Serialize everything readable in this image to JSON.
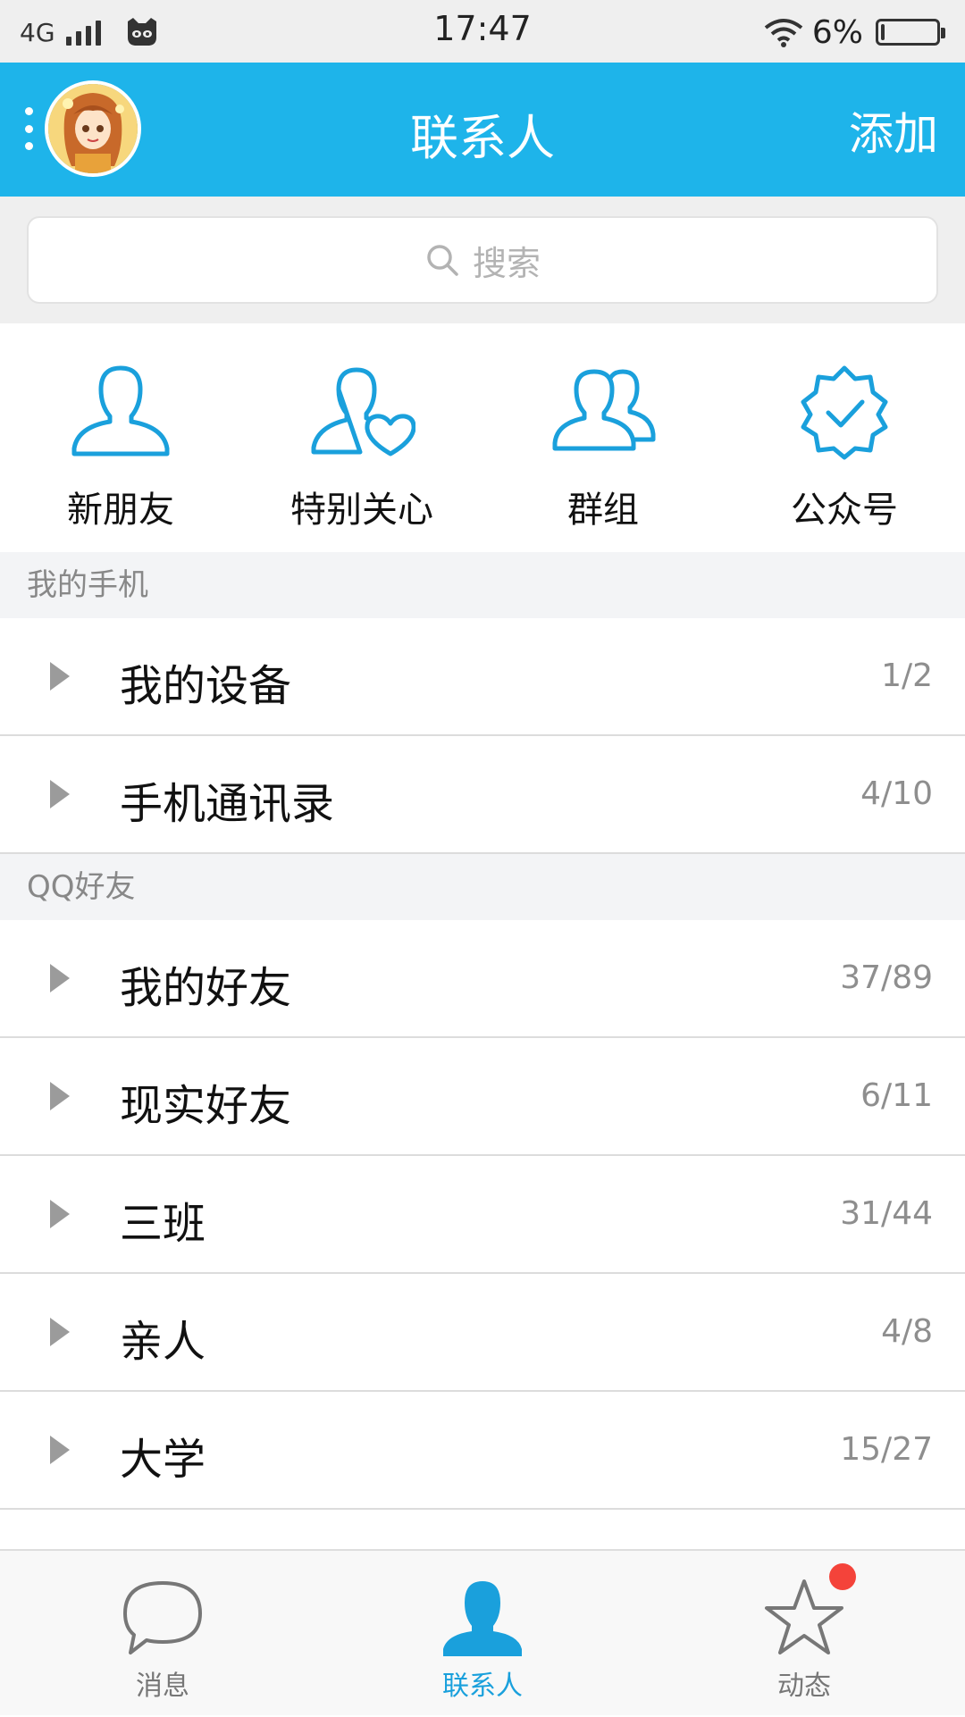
{
  "status_bar": {
    "network": "4G",
    "time": "17:47",
    "battery_text": "6%",
    "battery_level": 0.06
  },
  "header": {
    "title": "联系人",
    "add_label": "添加"
  },
  "search": {
    "placeholder": "搜索"
  },
  "quick_entries": [
    {
      "label": "新朋友",
      "icon": "person-icon"
    },
    {
      "label": "特别关心",
      "icon": "person-heart-icon"
    },
    {
      "label": "群组",
      "icon": "group-icon"
    },
    {
      "label": "公众号",
      "icon": "verified-badge-icon"
    }
  ],
  "sections": [
    {
      "title": "我的手机",
      "groups": [
        {
          "name": "我的设备",
          "count": "1/2"
        },
        {
          "name": "手机通讯录",
          "count": "4/10"
        }
      ]
    },
    {
      "title": "QQ好友",
      "groups": [
        {
          "name": "我的好友",
          "count": "37/89"
        },
        {
          "name": "现实好友",
          "count": "6/11"
        },
        {
          "name": "三班",
          "count": "31/44"
        },
        {
          "name": "亲人",
          "count": "4/8"
        },
        {
          "name": "大学",
          "count": "15/27"
        }
      ]
    }
  ],
  "bottom_nav": [
    {
      "label": "消息",
      "icon": "chat-bubble-icon",
      "active": false
    },
    {
      "label": "联系人",
      "icon": "contact-person-icon",
      "active": true
    },
    {
      "label": "动态",
      "icon": "star-icon",
      "active": false,
      "has_badge": true
    }
  ],
  "colors": {
    "brand": "#1eb4ea",
    "active_tab": "#1aa0dc",
    "badge": "#f4433a"
  }
}
